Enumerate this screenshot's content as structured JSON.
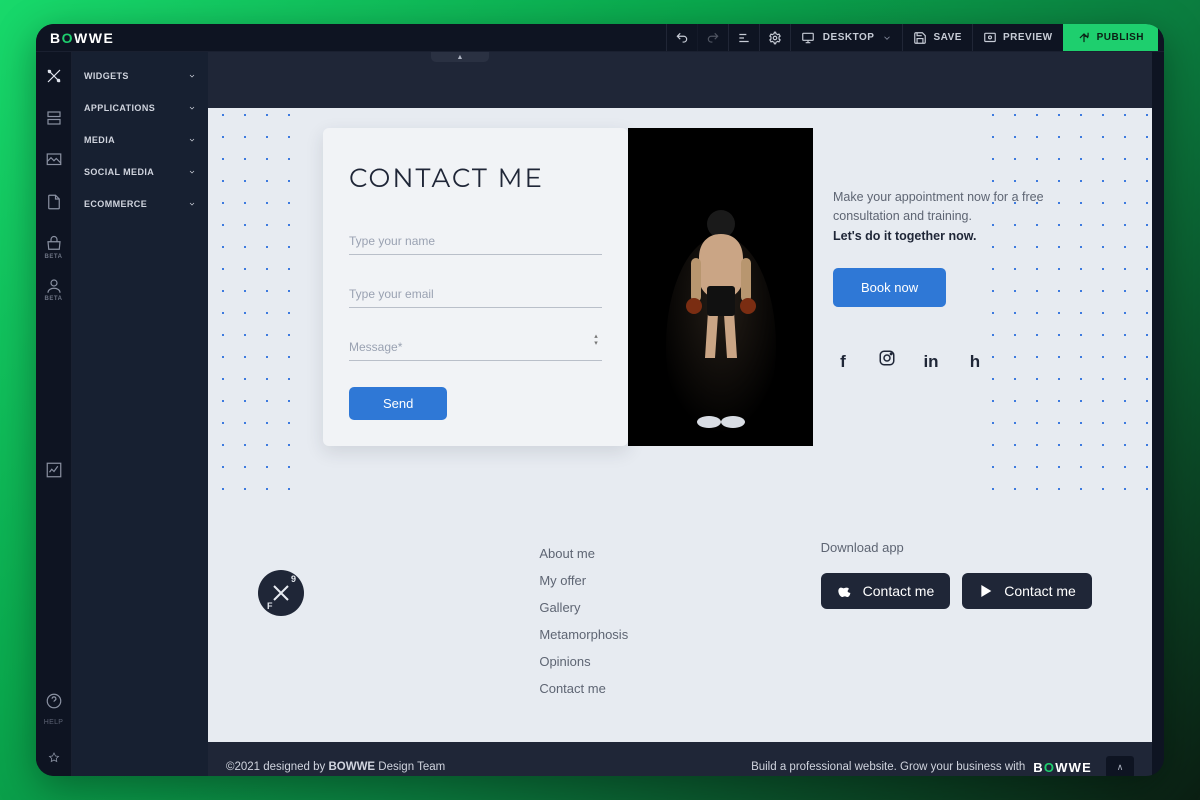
{
  "brand": {
    "pre": "B",
    "accent": "O",
    "post": "WWE"
  },
  "top": {
    "device": "Desktop",
    "save": "SAVE",
    "preview": "PREVIEW",
    "publish": "PUBLISH"
  },
  "rail_help": "HELP",
  "beta": "BETA",
  "panel": [
    "WIDGETS",
    "APPLICATIONS",
    "MEDIA",
    "SOCIAL MEDIA",
    "ECOMMERCE"
  ],
  "contact": {
    "heading": "CONTACT ME",
    "name_ph": "Type your name",
    "email_ph": "Type your email",
    "msg_ph": "Message*",
    "send": "Send"
  },
  "aside": {
    "line1": "Make your appointment now for a free consultation and training.",
    "line2": "Let's do it together now.",
    "book": "Book now"
  },
  "footer_nav": [
    "About me",
    "My offer",
    "Gallery",
    "Metamorphosis",
    "Opinions",
    "Contact me"
  ],
  "download": {
    "title": "Download app",
    "btn1": "Contact me",
    "btn2": "Contact me"
  },
  "bottom": {
    "copy_pre": "©2021 designed by ",
    "copy_brand": "BOWWE",
    "copy_post": " Design Team",
    "promo": "Build a professional website. Grow your business with"
  }
}
